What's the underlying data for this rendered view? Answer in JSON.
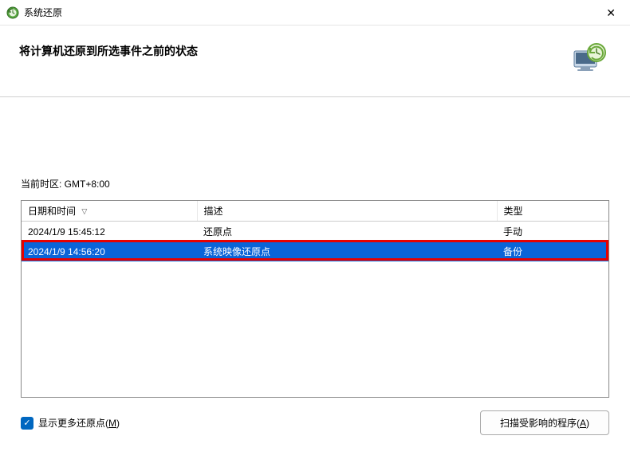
{
  "window": {
    "title": "系统还原"
  },
  "header": {
    "title": "将计算机还原到所选事件之前的状态"
  },
  "timezone": {
    "label": "当前时区: GMT+8:00"
  },
  "table": {
    "headers": {
      "date": "日期和时间",
      "desc": "描述",
      "type": "类型"
    },
    "rows": [
      {
        "date": "2024/1/9 15:45:12",
        "desc": "还原点",
        "type": "手动",
        "selected": false
      },
      {
        "date": "2024/1/9 14:56:20",
        "desc": "系统映像还原点",
        "type": "备份",
        "selected": true
      }
    ]
  },
  "checkbox": {
    "label_prefix": "显示更多还原点(",
    "label_key": "M",
    "label_suffix": ")"
  },
  "button": {
    "scan_prefix": "扫描受影响的程序(",
    "scan_key": "A",
    "scan_suffix": ")"
  }
}
